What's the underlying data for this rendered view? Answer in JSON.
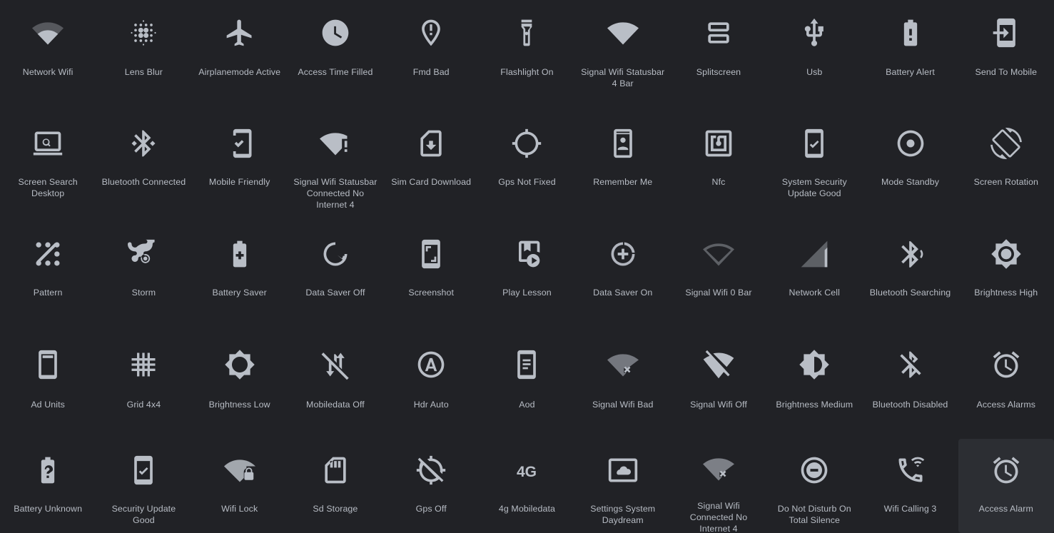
{
  "theme": {
    "background": "#212226",
    "icon_color": "#b9bec6",
    "label_color": "#b7bcc4",
    "selected_cell_background": "#2c2e33"
  },
  "gallery": {
    "columns": 11,
    "rows": 5,
    "total_icons": 55,
    "selected_icon": "Access Alarm",
    "items": [
      {
        "label": "Network Wifi",
        "icon": "network-wifi-icon"
      },
      {
        "label": "Lens Blur",
        "icon": "lens-blur-icon"
      },
      {
        "label": "Airplanemode Active",
        "icon": "airplanemode-active-icon"
      },
      {
        "label": "Access Time Filled",
        "icon": "access-time-filled-icon"
      },
      {
        "label": "Fmd Bad",
        "icon": "fmd-bad-icon"
      },
      {
        "label": "Flashlight On",
        "icon": "flashlight-on-icon"
      },
      {
        "label": "Signal Wifi Statusbar 4 Bar",
        "icon": "signal-wifi-statusbar-4-bar-icon"
      },
      {
        "label": "Splitscreen",
        "icon": "splitscreen-icon"
      },
      {
        "label": "Usb",
        "icon": "usb-icon"
      },
      {
        "label": "Battery Alert",
        "icon": "battery-alert-icon"
      },
      {
        "label": "Send To Mobile",
        "icon": "send-to-mobile-icon"
      },
      {
        "label": "Screen Search Desktop",
        "icon": "screen-search-desktop-icon"
      },
      {
        "label": "Bluetooth Connected",
        "icon": "bluetooth-connected-icon"
      },
      {
        "label": "Mobile Friendly",
        "icon": "mobile-friendly-icon"
      },
      {
        "label": "Signal Wifi Statusbar Connected No Internet 4",
        "icon": "signal-wifi-statusbar-connected-no-internet-4-icon"
      },
      {
        "label": "Sim Card Download",
        "icon": "sim-card-download-icon"
      },
      {
        "label": "Gps Not Fixed",
        "icon": "gps-not-fixed-icon"
      },
      {
        "label": "Remember Me",
        "icon": "remember-me-icon"
      },
      {
        "label": "Nfc",
        "icon": "nfc-icon"
      },
      {
        "label": "System Security Update Good",
        "icon": "system-security-update-good-icon"
      },
      {
        "label": "Mode Standby",
        "icon": "mode-standby-icon"
      },
      {
        "label": "Screen Rotation",
        "icon": "screen-rotation-icon"
      },
      {
        "label": "Pattern",
        "icon": "pattern-icon"
      },
      {
        "label": "Storm",
        "icon": "storm-icon"
      },
      {
        "label": "Battery Saver",
        "icon": "battery-saver-icon"
      },
      {
        "label": "Data Saver Off",
        "icon": "data-saver-off-icon"
      },
      {
        "label": "Screenshot",
        "icon": "screenshot-icon"
      },
      {
        "label": "Play Lesson",
        "icon": "play-lesson-icon"
      },
      {
        "label": "Data Saver On",
        "icon": "data-saver-on-icon"
      },
      {
        "label": "Signal Wifi 0 Bar",
        "icon": "signal-wifi-0-bar-icon"
      },
      {
        "label": "Network Cell",
        "icon": "network-cell-icon"
      },
      {
        "label": "Bluetooth Searching",
        "icon": "bluetooth-searching-icon"
      },
      {
        "label": "Brightness High",
        "icon": "brightness-high-icon"
      },
      {
        "label": "Ad Units",
        "icon": "ad-units-icon"
      },
      {
        "label": "Grid 4x4",
        "icon": "grid-4x4-icon"
      },
      {
        "label": "Brightness Low",
        "icon": "brightness-low-icon"
      },
      {
        "label": "Mobiledata Off",
        "icon": "mobiledata-off-icon"
      },
      {
        "label": "Hdr Auto",
        "icon": "hdr-auto-icon"
      },
      {
        "label": "Aod",
        "icon": "aod-icon"
      },
      {
        "label": "Signal Wifi Bad",
        "icon": "signal-wifi-bad-icon"
      },
      {
        "label": "Signal Wifi Off",
        "icon": "signal-wifi-off-icon"
      },
      {
        "label": "Brightness Medium",
        "icon": "brightness-medium-icon"
      },
      {
        "label": "Bluetooth Disabled",
        "icon": "bluetooth-disabled-icon"
      },
      {
        "label": "Access Alarms",
        "icon": "access-alarms-icon"
      },
      {
        "label": "Battery Unknown",
        "icon": "battery-unknown-icon"
      },
      {
        "label": "Security Update Good",
        "icon": "security-update-good-icon"
      },
      {
        "label": "Wifi Lock",
        "icon": "wifi-lock-icon"
      },
      {
        "label": "Sd Storage",
        "icon": "sd-storage-icon"
      },
      {
        "label": "Gps Off",
        "icon": "gps-off-icon"
      },
      {
        "label": "4g Mobiledata",
        "icon": "4g-mobiledata-icon"
      },
      {
        "label": "Settings System Daydream",
        "icon": "settings-system-daydream-icon"
      },
      {
        "label": "Signal Wifi Connected No Internet 4",
        "icon": "signal-wifi-connected-no-internet-4-icon"
      },
      {
        "label": "Do Not Disturb On Total Silence",
        "icon": "do-not-disturb-on-total-silence-icon"
      },
      {
        "label": "Wifi Calling 3",
        "icon": "wifi-calling-3-icon"
      },
      {
        "label": "Access Alarm",
        "icon": "access-alarm-icon"
      }
    ]
  }
}
